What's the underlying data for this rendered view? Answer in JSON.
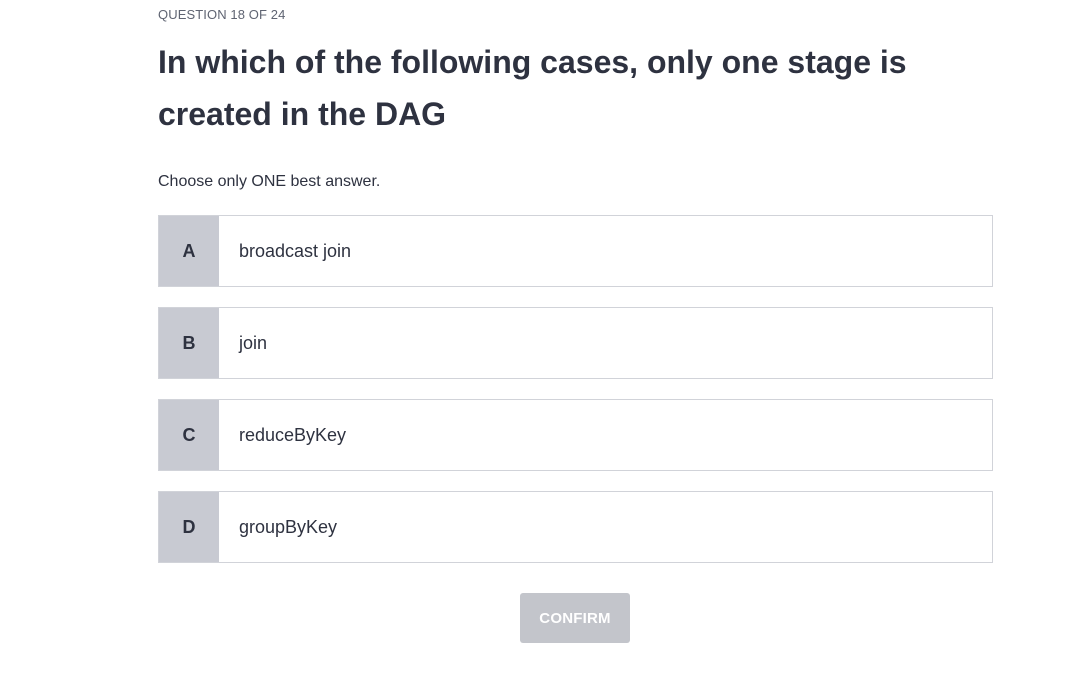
{
  "quiz": {
    "counter": "QUESTION 18 OF 24",
    "question": "In which of the following cases, only one stage is created in the DAG",
    "instruction": "Choose only ONE best answer.",
    "options": [
      {
        "letter": "A",
        "text": "broadcast join"
      },
      {
        "letter": "B",
        "text": "join"
      },
      {
        "letter": "C",
        "text": "reduceByKey"
      },
      {
        "letter": "D",
        "text": "groupByKey"
      }
    ],
    "confirm_label": "CONFIRM",
    "confirm_enabled": false
  },
  "colors": {
    "text": "#2e3240",
    "letter_bg": "#c8cad2",
    "border": "#d1d3d9",
    "confirm_disabled_bg": "#c3c5cb"
  }
}
